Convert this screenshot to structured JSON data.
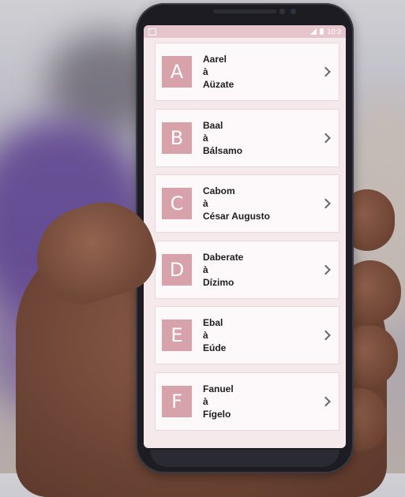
{
  "status_bar": {
    "time": "10:3"
  },
  "entries": [
    {
      "letter": "A",
      "from": "Aarel",
      "connector": "à",
      "to": "Aüzate"
    },
    {
      "letter": "B",
      "from": "Baal",
      "connector": "à",
      "to": "Bálsamo"
    },
    {
      "letter": "C",
      "from": "Cabom",
      "connector": "à",
      "to": "César Augusto"
    },
    {
      "letter": "D",
      "from": "Daberate",
      "connector": "à",
      "to": "Dízimo"
    },
    {
      "letter": "E",
      "from": "Ebal",
      "connector": "à",
      "to": "Eúde"
    },
    {
      "letter": "F",
      "from": "Fanuel",
      "connector": "à",
      "to": "Fígelo"
    }
  ],
  "colors": {
    "accent": "#d8a2ab",
    "header": "#e7c5cd",
    "card": "#fdf9fa"
  },
  "icons": {
    "row_action": "chevron-right-icon"
  }
}
